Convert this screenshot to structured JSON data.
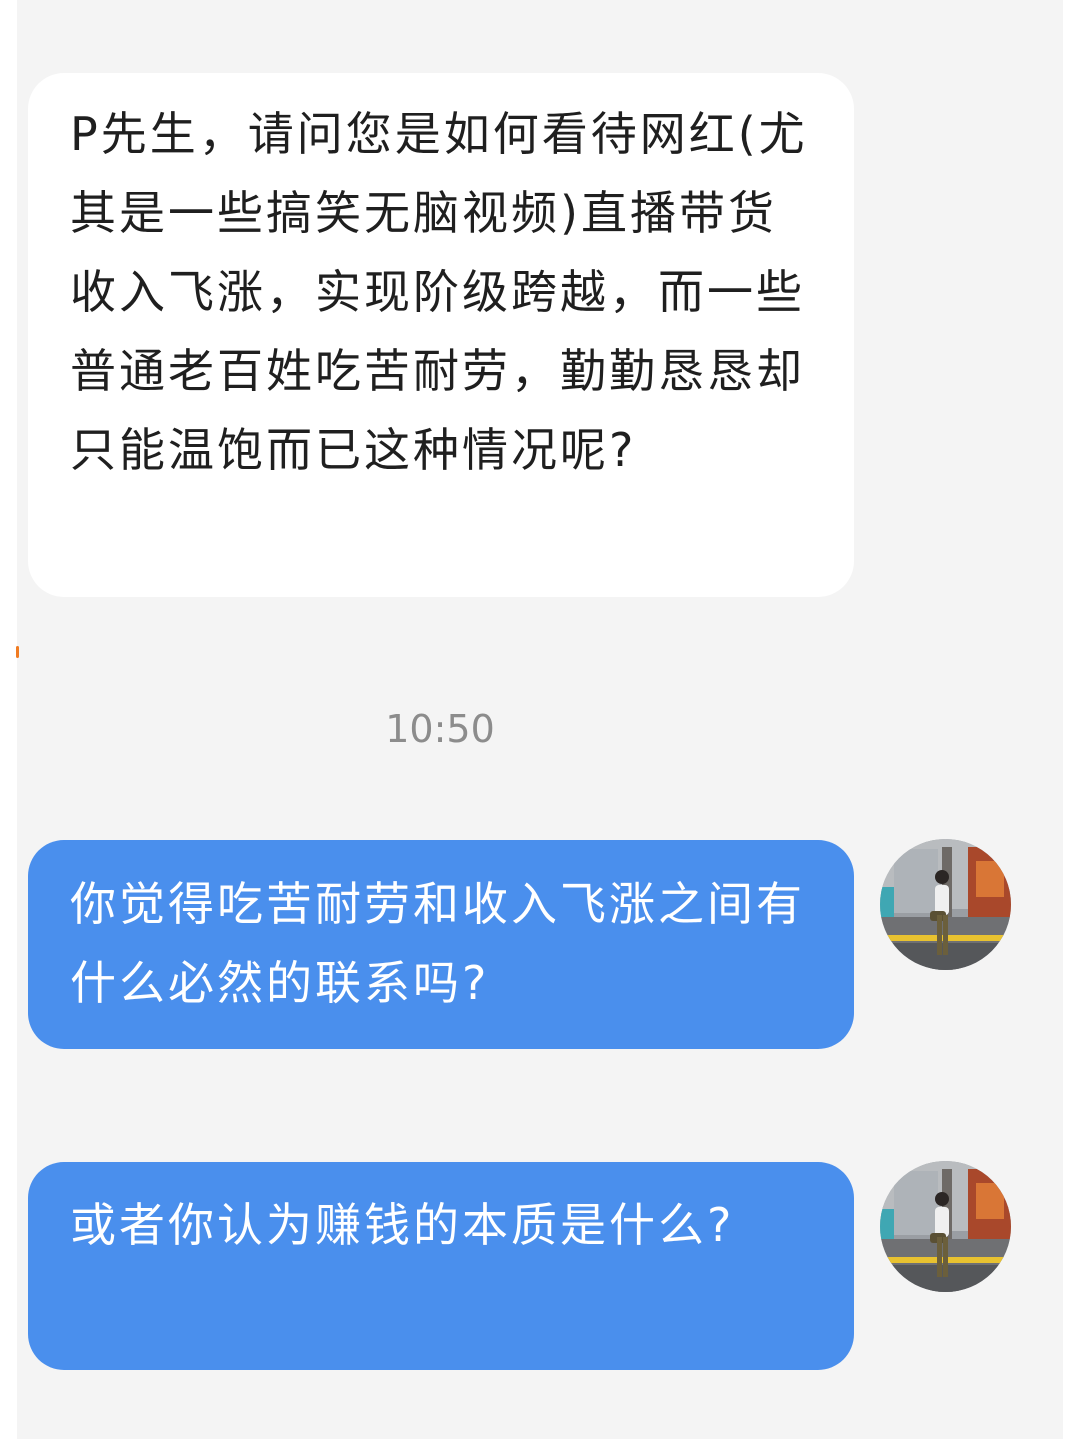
{
  "colors": {
    "page_background": "#ffffff",
    "chat_background": "#f4f4f4",
    "incoming_bubble": "#ffffff",
    "incoming_text": "#1f1f1f",
    "outgoing_bubble": "#4a8fed",
    "outgoing_text": "#ffffff",
    "timestamp_text": "#8c8c8c",
    "side_mark": "#f07b21"
  },
  "messages": [
    {
      "direction": "incoming",
      "text": "P先生，请问您是如何看待网红(尤其是一些搞笑无脑视频)直播带货收入飞涨，实现阶级跨越，而一些普通老百姓吃苦耐劳，勤勤恳恳却只能温饱而已这种情况呢?"
    },
    {
      "direction": "outgoing",
      "text": "你觉得吃苦耐劳和收入飞涨之间有什么必然的联系吗?",
      "avatar": "user-avatar-photo"
    },
    {
      "direction": "outgoing",
      "text": "或者你认为赚钱的本质是什么?",
      "avatar": "user-avatar-photo"
    }
  ],
  "timestamp": "10:50"
}
